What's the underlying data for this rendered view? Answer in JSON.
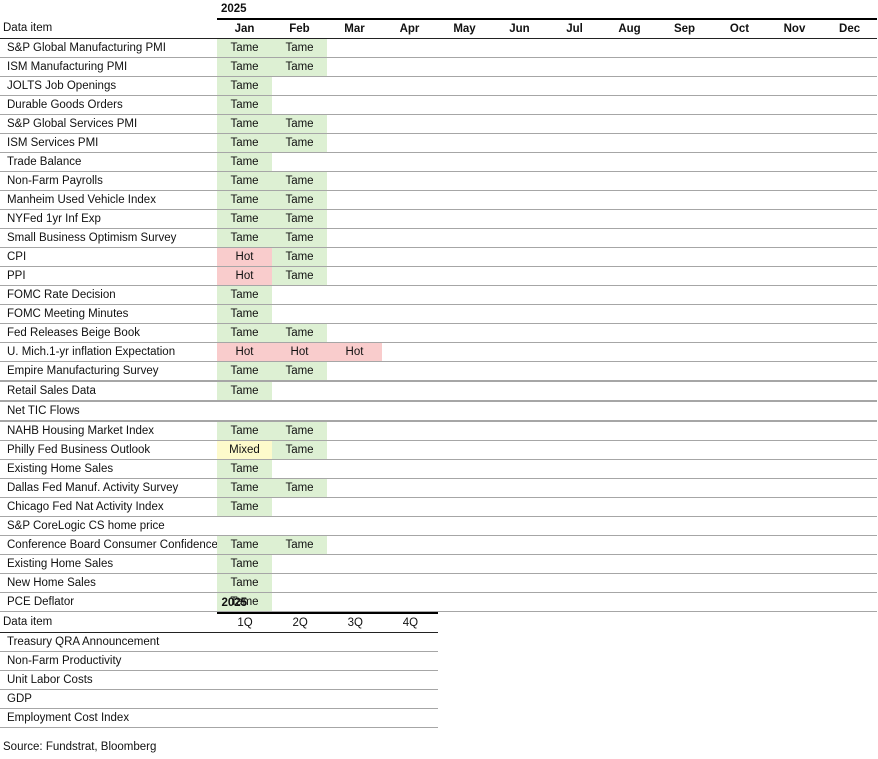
{
  "monthly_table": {
    "year_label": "2025",
    "item_header": "Data item",
    "months": [
      "Jan",
      "Feb",
      "Mar",
      "Apr",
      "May",
      "Jun",
      "Jul",
      "Aug",
      "Sep",
      "Oct",
      "Nov",
      "Dec"
    ],
    "status_colors": {
      "Tame": "#ddf0d3",
      "Hot": "#f9cccc",
      "Mixed": "#fdfacb"
    },
    "rows": [
      {
        "item": "S&P Global Manufacturing PMI",
        "values": [
          "Tame",
          "Tame"
        ]
      },
      {
        "item": "ISM Manufacturing PMI",
        "values": [
          "Tame",
          "Tame"
        ]
      },
      {
        "item": "JOLTS Job Openings",
        "values": [
          "Tame"
        ]
      },
      {
        "item": "Durable Goods Orders",
        "values": [
          "Tame"
        ]
      },
      {
        "item": "S&P Global Services PMI",
        "values": [
          "Tame",
          "Tame"
        ]
      },
      {
        "item": "ISM Services PMI",
        "values": [
          "Tame",
          "Tame"
        ]
      },
      {
        "item": "Trade Balance",
        "values": [
          "Tame"
        ]
      },
      {
        "item": "Non-Farm Payrolls",
        "values": [
          "Tame",
          "Tame"
        ]
      },
      {
        "item": "Manheim Used Vehicle Index",
        "values": [
          "Tame",
          "Tame"
        ]
      },
      {
        "item": "NYFed 1yr Inf Exp",
        "values": [
          "Tame",
          "Tame"
        ]
      },
      {
        "item": "Small Business Optimism Survey",
        "values": [
          "Tame",
          "Tame"
        ]
      },
      {
        "item": "CPI",
        "values": [
          "Hot",
          "Tame"
        ]
      },
      {
        "item": "PPI",
        "values": [
          "Hot",
          "Tame"
        ]
      },
      {
        "item": "FOMC Rate Decision",
        "values": [
          "Tame"
        ]
      },
      {
        "item": "FOMC Meeting Minutes",
        "values": [
          "Tame"
        ]
      },
      {
        "item": "Fed Releases Beige Book",
        "values": [
          "Tame",
          "Tame"
        ]
      },
      {
        "item": "U. Mich.1-yr  inflation Expectation",
        "values": [
          "Hot",
          "Hot",
          "Hot"
        ]
      },
      {
        "item": "Empire Manufacturing Survey",
        "values": [
          "Tame",
          "Tame"
        ],
        "thick": true
      },
      {
        "item": "Retail Sales Data",
        "values": [
          "Tame"
        ],
        "thick": true
      },
      {
        "item": "Net TIC Flows",
        "values": [],
        "thick": true
      },
      {
        "item": "NAHB Housing Market Index",
        "values": [
          "Tame",
          "Tame"
        ]
      },
      {
        "item": "Philly Fed Business Outlook",
        "values": [
          "Mixed",
          "Tame"
        ]
      },
      {
        "item": "Existing Home Sales",
        "values": [
          "Tame"
        ]
      },
      {
        "item": "Dallas Fed Manuf. Activity Survey",
        "values": [
          "Tame",
          "Tame"
        ]
      },
      {
        "item": "Chicago Fed Nat Activity Index",
        "values": [
          "Tame"
        ]
      },
      {
        "item": "S&P CoreLogic CS home price",
        "values": []
      },
      {
        "item": "Conference Board Consumer Confidence",
        "values": [
          "Tame",
          "Tame"
        ]
      },
      {
        "item": "Existing Home Sales",
        "values": [
          "Tame"
        ]
      },
      {
        "item": "New Home Sales",
        "values": [
          "Tame"
        ]
      },
      {
        "item": "PCE Deflator",
        "values": [
          "Tame"
        ]
      }
    ]
  },
  "quarterly_table": {
    "year_label": "2025",
    "item_header": "Data item",
    "quarters": [
      "1Q",
      "2Q",
      "3Q",
      "4Q"
    ],
    "rows": [
      {
        "item": "Treasury QRA Announcement",
        "values": []
      },
      {
        "item": "Non-Farm Productivity",
        "values": []
      },
      {
        "item": "Unit Labor Costs",
        "values": []
      },
      {
        "item": "GDP",
        "values": []
      },
      {
        "item": "Employment Cost Index",
        "values": []
      }
    ]
  },
  "source": "Source: Fundstrat, Bloomberg"
}
